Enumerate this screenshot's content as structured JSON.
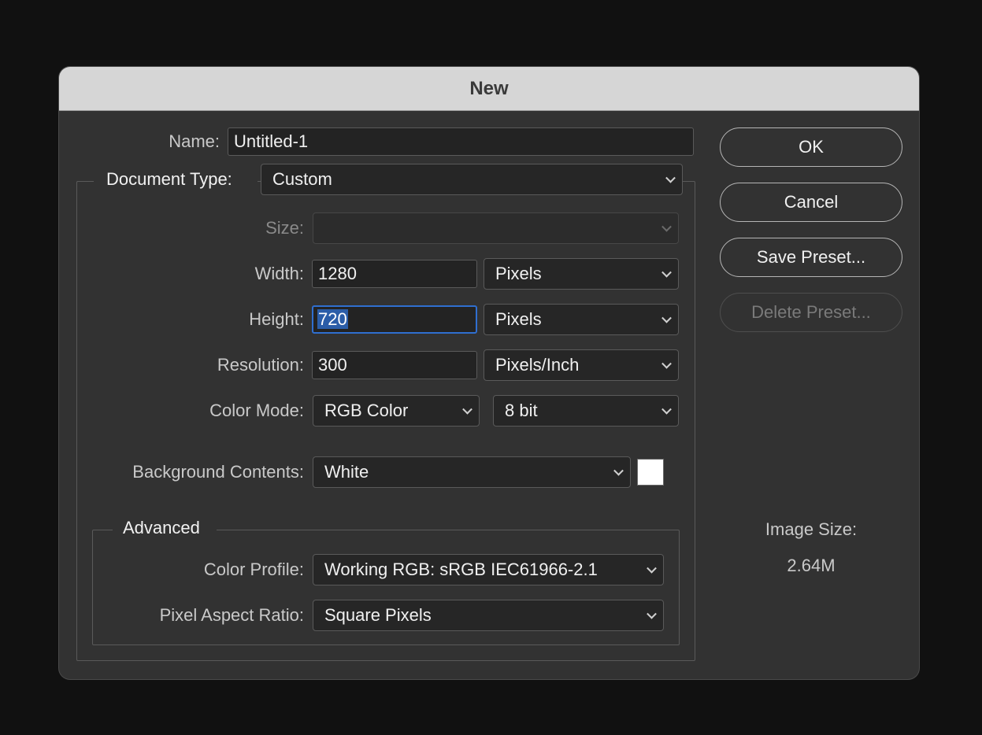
{
  "dialog": {
    "title": "New"
  },
  "form": {
    "name_label": "Name:",
    "name_value": "Untitled-1",
    "doctype_label": "Document Type:",
    "doctype_value": "Custom",
    "size_label": "Size:",
    "size_value": "",
    "width_label": "Width:",
    "width_value": "1280",
    "width_unit": "Pixels",
    "height_label": "Height:",
    "height_value": "720",
    "height_unit": "Pixels",
    "resolution_label": "Resolution:",
    "resolution_value": "300",
    "resolution_unit": "Pixels/Inch",
    "colormode_label": "Color Mode:",
    "colormode_value": "RGB Color",
    "bitdepth_value": "8 bit",
    "background_label": "Background Contents:",
    "background_value": "White",
    "background_swatch_color": "#ffffff"
  },
  "advanced": {
    "legend": "Advanced",
    "profile_label": "Color Profile:",
    "profile_value": "Working RGB:  sRGB IEC61966-2.1",
    "aspect_label": "Pixel Aspect Ratio:",
    "aspect_value": "Square Pixels"
  },
  "buttons": {
    "ok": "OK",
    "cancel": "Cancel",
    "save_preset": "Save Preset...",
    "delete_preset": "Delete Preset..."
  },
  "info": {
    "image_size_label": "Image Size:",
    "image_size_value": "2.64M"
  },
  "colors": {
    "background": "#111111",
    "dialog": "#323232",
    "titlebar": "#d6d6d6",
    "focus": "#2f6fd0",
    "selection": "#2b5da8"
  }
}
